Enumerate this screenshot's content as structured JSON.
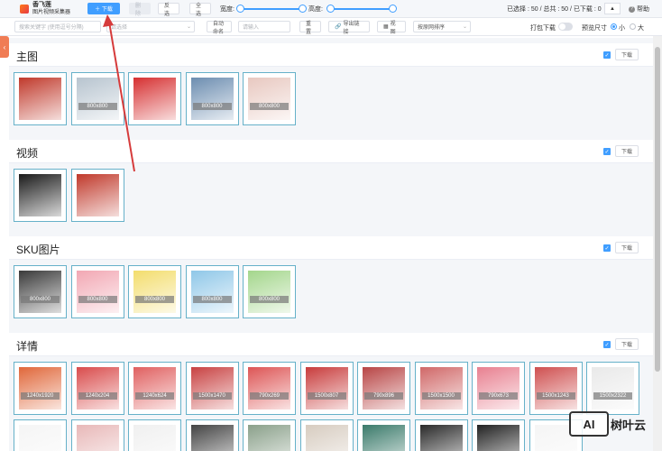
{
  "app": {
    "name_line1": "香飞莲",
    "name_line2": "图片视频采集器"
  },
  "toolbar": {
    "download_label": "＋ 下载",
    "clear_label": "删除",
    "invert_label": "反选",
    "select_all_label": "全选",
    "width_label": "宽度:",
    "height_label": "高度:",
    "stats": "已选择 : 50 / 总共 : 50 / 已下载 : 0",
    "collapse_label": "▲",
    "help_label": "帮助"
  },
  "filter": {
    "keyword_placeholder": "搜索关键字 (使用逗号分隔)",
    "type_placeholder": "请选择",
    "auto_label": "自动命名",
    "name_placeholder": "请输入",
    "reset_label": "重置",
    "export_label": "导出链接",
    "view_label": "视图",
    "sort_label": "按原网排序",
    "pack_label": "打包下载",
    "preview_label": "预览尺寸",
    "small_label": "小",
    "large_label": "大"
  },
  "section_download_label": "下载",
  "sections": [
    {
      "title": "主图",
      "items": [
        {
          "size": "",
          "color": "#c0392b"
        },
        {
          "size": "800x800",
          "color": "#b7c4cf"
        },
        {
          "size": "",
          "color": "#d63031"
        },
        {
          "size": "800x800",
          "color": "#6c8db0"
        },
        {
          "size": "800x800",
          "color": "#e8c8c0"
        }
      ]
    },
    {
      "title": "视频",
      "items": [
        {
          "size": "",
          "color": "#1a1a1a"
        },
        {
          "size": "",
          "color": "#c0392b"
        }
      ]
    },
    {
      "title": "SKU图片",
      "items": [
        {
          "size": "800x800",
          "color": "#3a3a3a"
        },
        {
          "size": "800x800",
          "color": "#f2a7b3"
        },
        {
          "size": "800x800",
          "color": "#f3dd6d"
        },
        {
          "size": "800x800",
          "color": "#8fc7e8"
        },
        {
          "size": "800x800",
          "color": "#a3d68b"
        }
      ]
    },
    {
      "title": "详情",
      "items": [
        {
          "size": "1240x1920",
          "color": "#e0673a"
        },
        {
          "size": "1240x204",
          "color": "#d94c4c"
        },
        {
          "size": "1240x624",
          "color": "#e06060"
        },
        {
          "size": "1500x1470",
          "color": "#c84242"
        },
        {
          "size": "790x269",
          "color": "#dd5555"
        },
        {
          "size": "1500x807",
          "color": "#c83c3c"
        },
        {
          "size": "790x896",
          "color": "#b84545"
        },
        {
          "size": "1500x1500",
          "color": "#d06868"
        },
        {
          "size": "790x673",
          "color": "#e88090"
        },
        {
          "size": "1500x1243",
          "color": "#cf5050"
        },
        {
          "size": "1500x2322",
          "color": "#e9e9e9"
        },
        {
          "size": "",
          "color": "#f5f5f5"
        },
        {
          "size": "",
          "color": "#e8b8b8"
        },
        {
          "size": "",
          "color": "#f0f0f0"
        },
        {
          "size": "",
          "color": "#444444"
        },
        {
          "size": "",
          "color": "#8aa08a"
        },
        {
          "size": "",
          "color": "#d7ccc0"
        },
        {
          "size": "",
          "color": "#3a7a6a"
        },
        {
          "size": "",
          "color": "#2a2a2a"
        },
        {
          "size": "",
          "color": "#222222"
        },
        {
          "size": "",
          "color": "#f5f5f5"
        }
      ]
    }
  ],
  "watermark": {
    "box": "AI",
    "text": "树叶云"
  },
  "colors": {
    "primary": "#409eff",
    "accent_arrow": "#d63b3b",
    "side_tab": "#f07c54"
  }
}
